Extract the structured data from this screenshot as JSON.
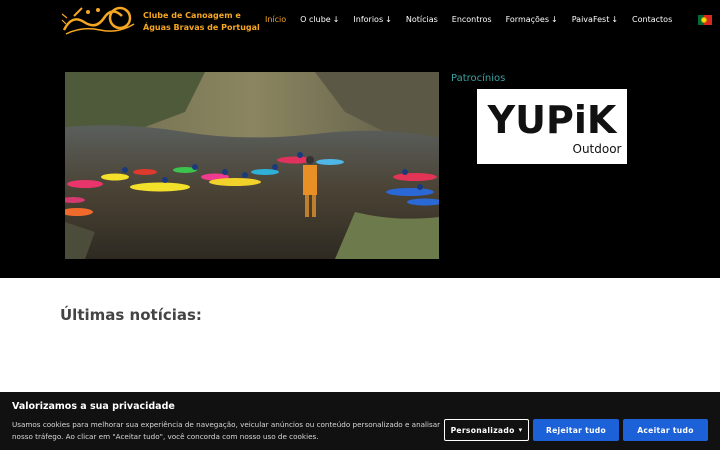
{
  "header": {
    "logo_alt": "CCABP logo",
    "site_name_line1": "Clube de Canoagem e",
    "site_name_line2": "Águas Bravas de Portugal",
    "nav": [
      {
        "label": "Início",
        "active": true,
        "dropdown": false
      },
      {
        "label": "O clube",
        "active": false,
        "dropdown": true
      },
      {
        "label": "Inforios",
        "active": false,
        "dropdown": true
      },
      {
        "label": "Notícias",
        "active": false,
        "dropdown": false
      },
      {
        "label": "Encontros",
        "active": false,
        "dropdown": false
      },
      {
        "label": "Formações",
        "active": false,
        "dropdown": true
      },
      {
        "label": "PaivaFest",
        "active": false,
        "dropdown": true
      },
      {
        "label": "Contactos",
        "active": false,
        "dropdown": false
      }
    ],
    "language_icon": "portugal-flag-icon",
    "accent_color": "#f5a623"
  },
  "hero": {
    "sponsors_title": "Patrocínios",
    "sponsor_logo_text": "YUPiK",
    "sponsor_logo_subtext": "Outdoor"
  },
  "news": {
    "title": "Últimas notícias:"
  },
  "cookie_banner": {
    "title": "Valorizamos a sua privacidade",
    "text": "Usamos cookies para melhorar sua experiência de navegação, veicular anúncios ou conteúdo personalizado e analisar nosso tráfego. Ao clicar em \"Aceitar tudo\", você concorda com nosso uso de cookies.",
    "custom_label": "Personalizado",
    "reject_label": "Rejeitar tudo",
    "accept_label": "Aceitar tudo",
    "button_color": "#1d61d8"
  }
}
